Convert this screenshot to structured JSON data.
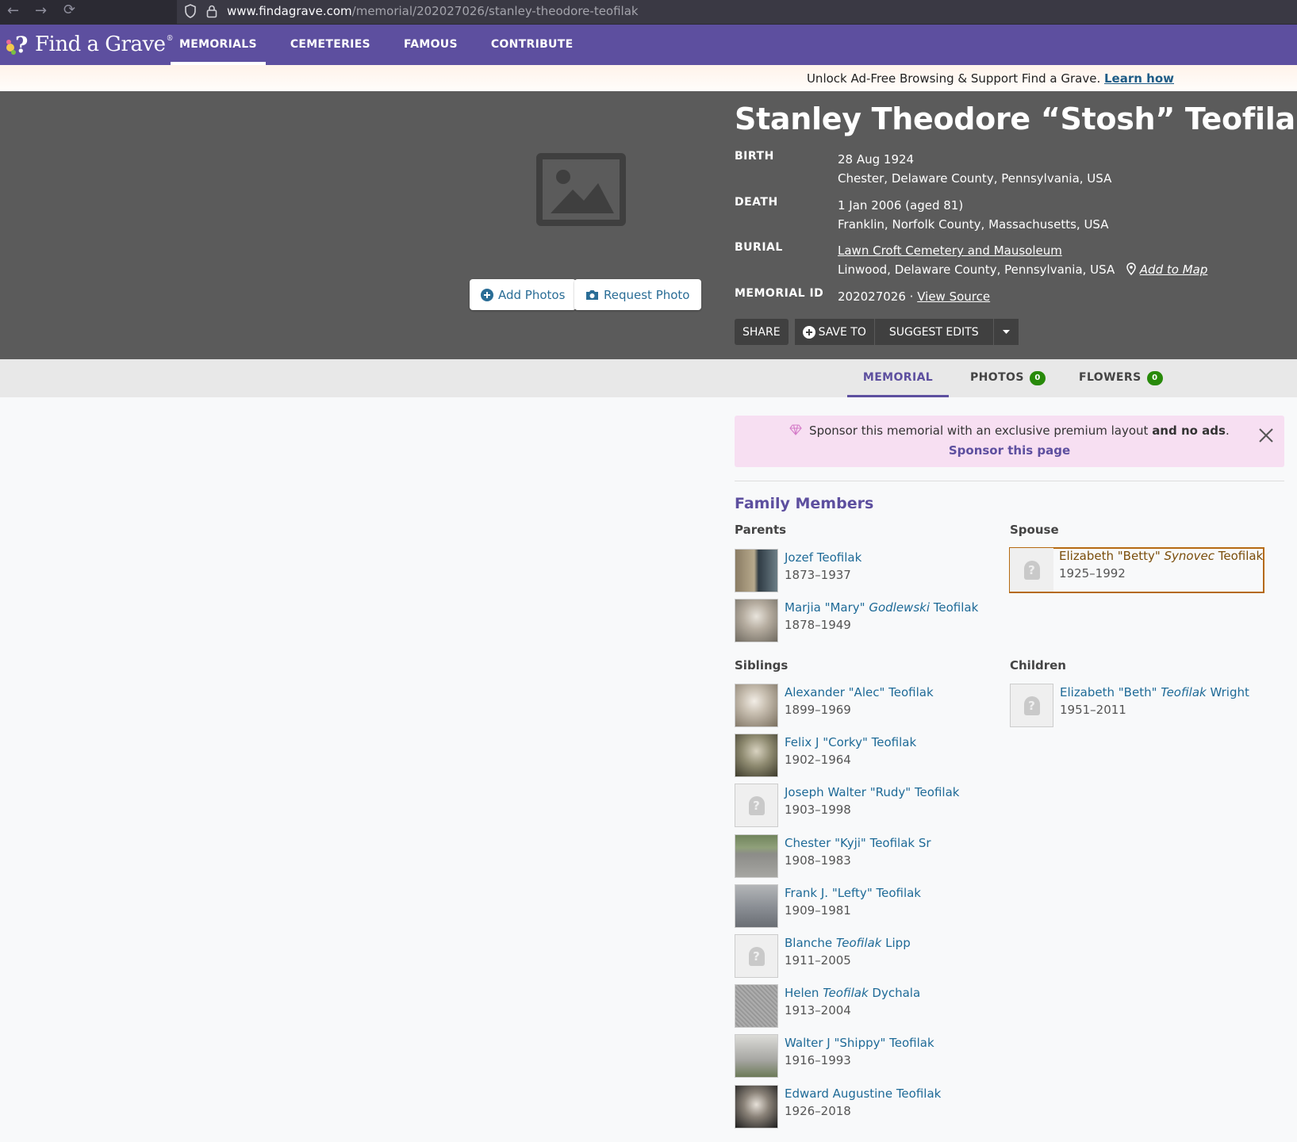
{
  "browser": {
    "url_host": "www.findagrave.com",
    "url_path": "/memorial/202027026/stanley-theodore-teofilak"
  },
  "header": {
    "logo_text": "Find a Grave",
    "nav": [
      "MEMORIALS",
      "CEMETERIES",
      "FAMOUS",
      "CONTRIBUTE"
    ]
  },
  "promo": {
    "text": "Unlock Ad-Free Browsing & Support Find a Grave.",
    "link": "Learn how"
  },
  "hero": {
    "add_photos": "Add Photos",
    "request_photo": "Request Photo",
    "title": "Stanley Theodore “Stosh” Teofilak",
    "birth_label": "BIRTH",
    "birth_date": "28 Aug 1924",
    "birth_place": "Chester, Delaware County, Pennsylvania, USA",
    "death_label": "DEATH",
    "death_date": "1 Jan 2006 (aged 81)",
    "death_place": "Franklin, Norfolk County, Massachusetts, USA",
    "burial_label": "BURIAL",
    "burial_cemetery": "Lawn Croft Cemetery and Mausoleum",
    "burial_place": "Linwood, Delaware County, Pennsylvania, USA",
    "add_to_map": "Add to Map",
    "memorial_id_label": "MEMORIAL ID",
    "memorial_id": "202027026 ·",
    "view_source": "View Source",
    "share": "SHARE",
    "save_to": "SAVE TO",
    "suggest_edits": "SUGGEST EDITS"
  },
  "tabs": {
    "memorial": "MEMORIAL",
    "photos": "PHOTOS",
    "photos_count": "0",
    "flowers": "FLOWERS",
    "flowers_count": "0"
  },
  "sponsor": {
    "text_a": "Sponsor this memorial with an exclusive premium layout",
    "text_b": "and no ads",
    "text_c": ".",
    "link": "Sponsor this page"
  },
  "family": {
    "title": "Family Members",
    "parents_label": "Parents",
    "spouse_label": "Spouse",
    "siblings_label": "Siblings",
    "children_label": "Children",
    "parents": [
      {
        "pre": "Jozef Teofilak",
        "mid": "",
        "post": "",
        "dates": "1873–1937"
      },
      {
        "pre": "Marjia \"Mary\" ",
        "mid": "Godlewski",
        "post": " Teofilak",
        "dates": "1878–1949"
      }
    ],
    "spouse": [
      {
        "pre": "Elizabeth \"Betty\" ",
        "mid": "Synovec",
        "post": " Teofilak",
        "dates": "1925–1992"
      }
    ],
    "siblings": [
      {
        "pre": "Alexander \"Alec\" Teofilak",
        "mid": "",
        "post": "",
        "dates": "1899–1969"
      },
      {
        "pre": "Felix J \"Corky\" Teofilak",
        "mid": "",
        "post": "",
        "dates": "1902–1964"
      },
      {
        "pre": "Joseph Walter \"Rudy\" Teofilak",
        "mid": "",
        "post": "",
        "dates": "1903–1998"
      },
      {
        "pre": "Chester \"Kyji\" Teofilak Sr",
        "mid": "",
        "post": "",
        "dates": "1908–1983"
      },
      {
        "pre": "Frank J. \"Lefty\" Teofilak",
        "mid": "",
        "post": "",
        "dates": "1909–1981"
      },
      {
        "pre": "Blanche ",
        "mid": "Teofilak",
        "post": " Lipp",
        "dates": "1911–2005"
      },
      {
        "pre": "Helen ",
        "mid": "Teofilak",
        "post": " Dychala",
        "dates": "1913–2004"
      },
      {
        "pre": "Walter J \"Shippy\" Teofilak",
        "mid": "",
        "post": "",
        "dates": "1916–1993"
      },
      {
        "pre": "Edward Augustine Teofilak",
        "mid": "",
        "post": "",
        "dates": "1926–2018"
      }
    ],
    "children": [
      {
        "pre": "Elizabeth \"Beth\" ",
        "mid": "Teofilak",
        "post": " Wright",
        "dates": "1951–2011"
      }
    ]
  }
}
